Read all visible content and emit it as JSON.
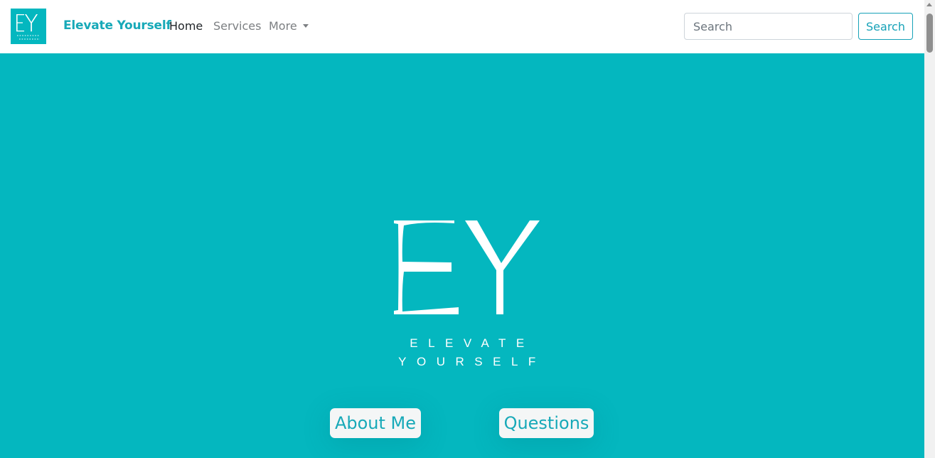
{
  "navbar": {
    "logo_text": "EY",
    "brand": "Elevate Yourself",
    "links": [
      {
        "label": "Home",
        "active": true
      },
      {
        "label": "Services",
        "active": false
      },
      {
        "label": "More",
        "active": false,
        "dropdown": true
      }
    ],
    "search": {
      "placeholder": "Search",
      "value": "",
      "button_label": "Search"
    }
  },
  "hero": {
    "logo_text": "EY",
    "tagline_line1": "ELEVATE",
    "tagline_line2": "YOURSELF",
    "buttons": [
      {
        "label": "About Me"
      },
      {
        "label": "Questions"
      }
    ]
  },
  "colors": {
    "accent": "#04b7bf",
    "brand_text": "#17a9b8",
    "button_bg": "#f4f6f6",
    "nav_bg": "#ffffff"
  },
  "icons": {
    "dropdown": "caret-down-icon"
  }
}
